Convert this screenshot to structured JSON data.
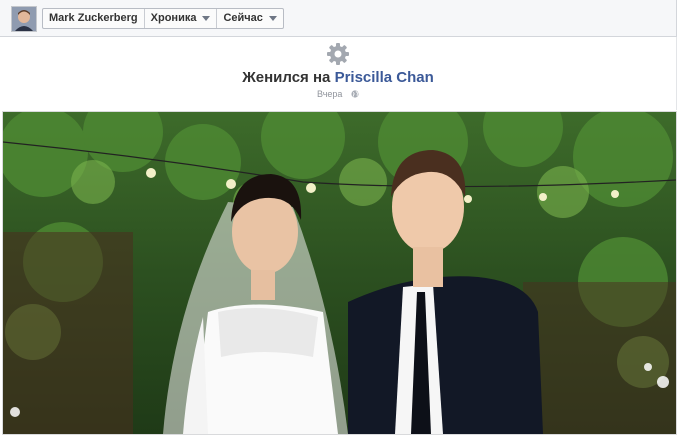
{
  "timeline_nav": {
    "profile_name": "Mark Zuckerberg",
    "section_label": "Хроника",
    "period_label": "Сейчас"
  },
  "event": {
    "verb": "Женился на",
    "partner_name": "Priscilla Chan",
    "timestamp": "Вчера"
  },
  "icons": {
    "settings": "gear-icon",
    "audience": "globe-icon"
  },
  "colors": {
    "link": "#3b5998",
    "title_text": "#333333",
    "meta_text": "#90949c"
  }
}
